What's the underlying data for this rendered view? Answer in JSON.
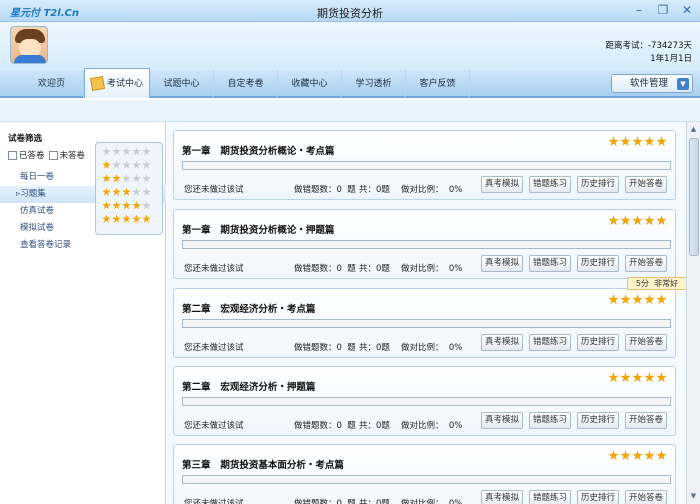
{
  "app": {
    "logo_text": "星元付 T2l.Cn",
    "title": "期货投资分析"
  },
  "header": {
    "countdown_label": "距离考试：-734273天",
    "countdown_date": "1年1月1日"
  },
  "nav": {
    "items": [
      {
        "label": "欢迎页"
      },
      {
        "label": "考试中心"
      },
      {
        "label": "试题中心"
      },
      {
        "label": "自定考卷"
      },
      {
        "label": "收藏中心"
      },
      {
        "label": "学习透析"
      },
      {
        "label": "客户反馈"
      }
    ],
    "active_index": 1,
    "software_button": "软件管理"
  },
  "sidebar": {
    "title": "试卷筛选",
    "filters": [
      "已答卷",
      "未答卷"
    ],
    "links": [
      "每日一卷",
      "习题集",
      "仿真试卷",
      "模拟试卷",
      "查看答卷记录"
    ],
    "star_ratings": [
      0,
      1,
      2,
      3,
      4,
      5
    ]
  },
  "cards": [
    {
      "title": "第一章   期货投资分析概论・考点篇",
      "stars": 5
    },
    {
      "title": "第一章   期货投资分析概论・押题篇",
      "stars": 5
    },
    {
      "title": "第二章   宏观经济分析・考点篇",
      "stars": 5
    },
    {
      "title": "第二章   宏观经济分析・押题篇",
      "stars": 5
    },
    {
      "title": "第三章   期货投资基本面分析・考点篇",
      "stars": 5
    }
  ],
  "card_info": {
    "status": "您还未做过该试",
    "wrong_count": "做错题数：0  题",
    "total": "共：0题",
    "ratio": "做对比例：  0%"
  },
  "card_buttons": [
    "真考模拟",
    "错题练习",
    "历史排行",
    "开始答卷"
  ],
  "tooltip": "5分  非常好",
  "colors": {
    "accent": "#1d79c4",
    "star_on": "#f0a500",
    "star_off": "#c8cdd4"
  }
}
